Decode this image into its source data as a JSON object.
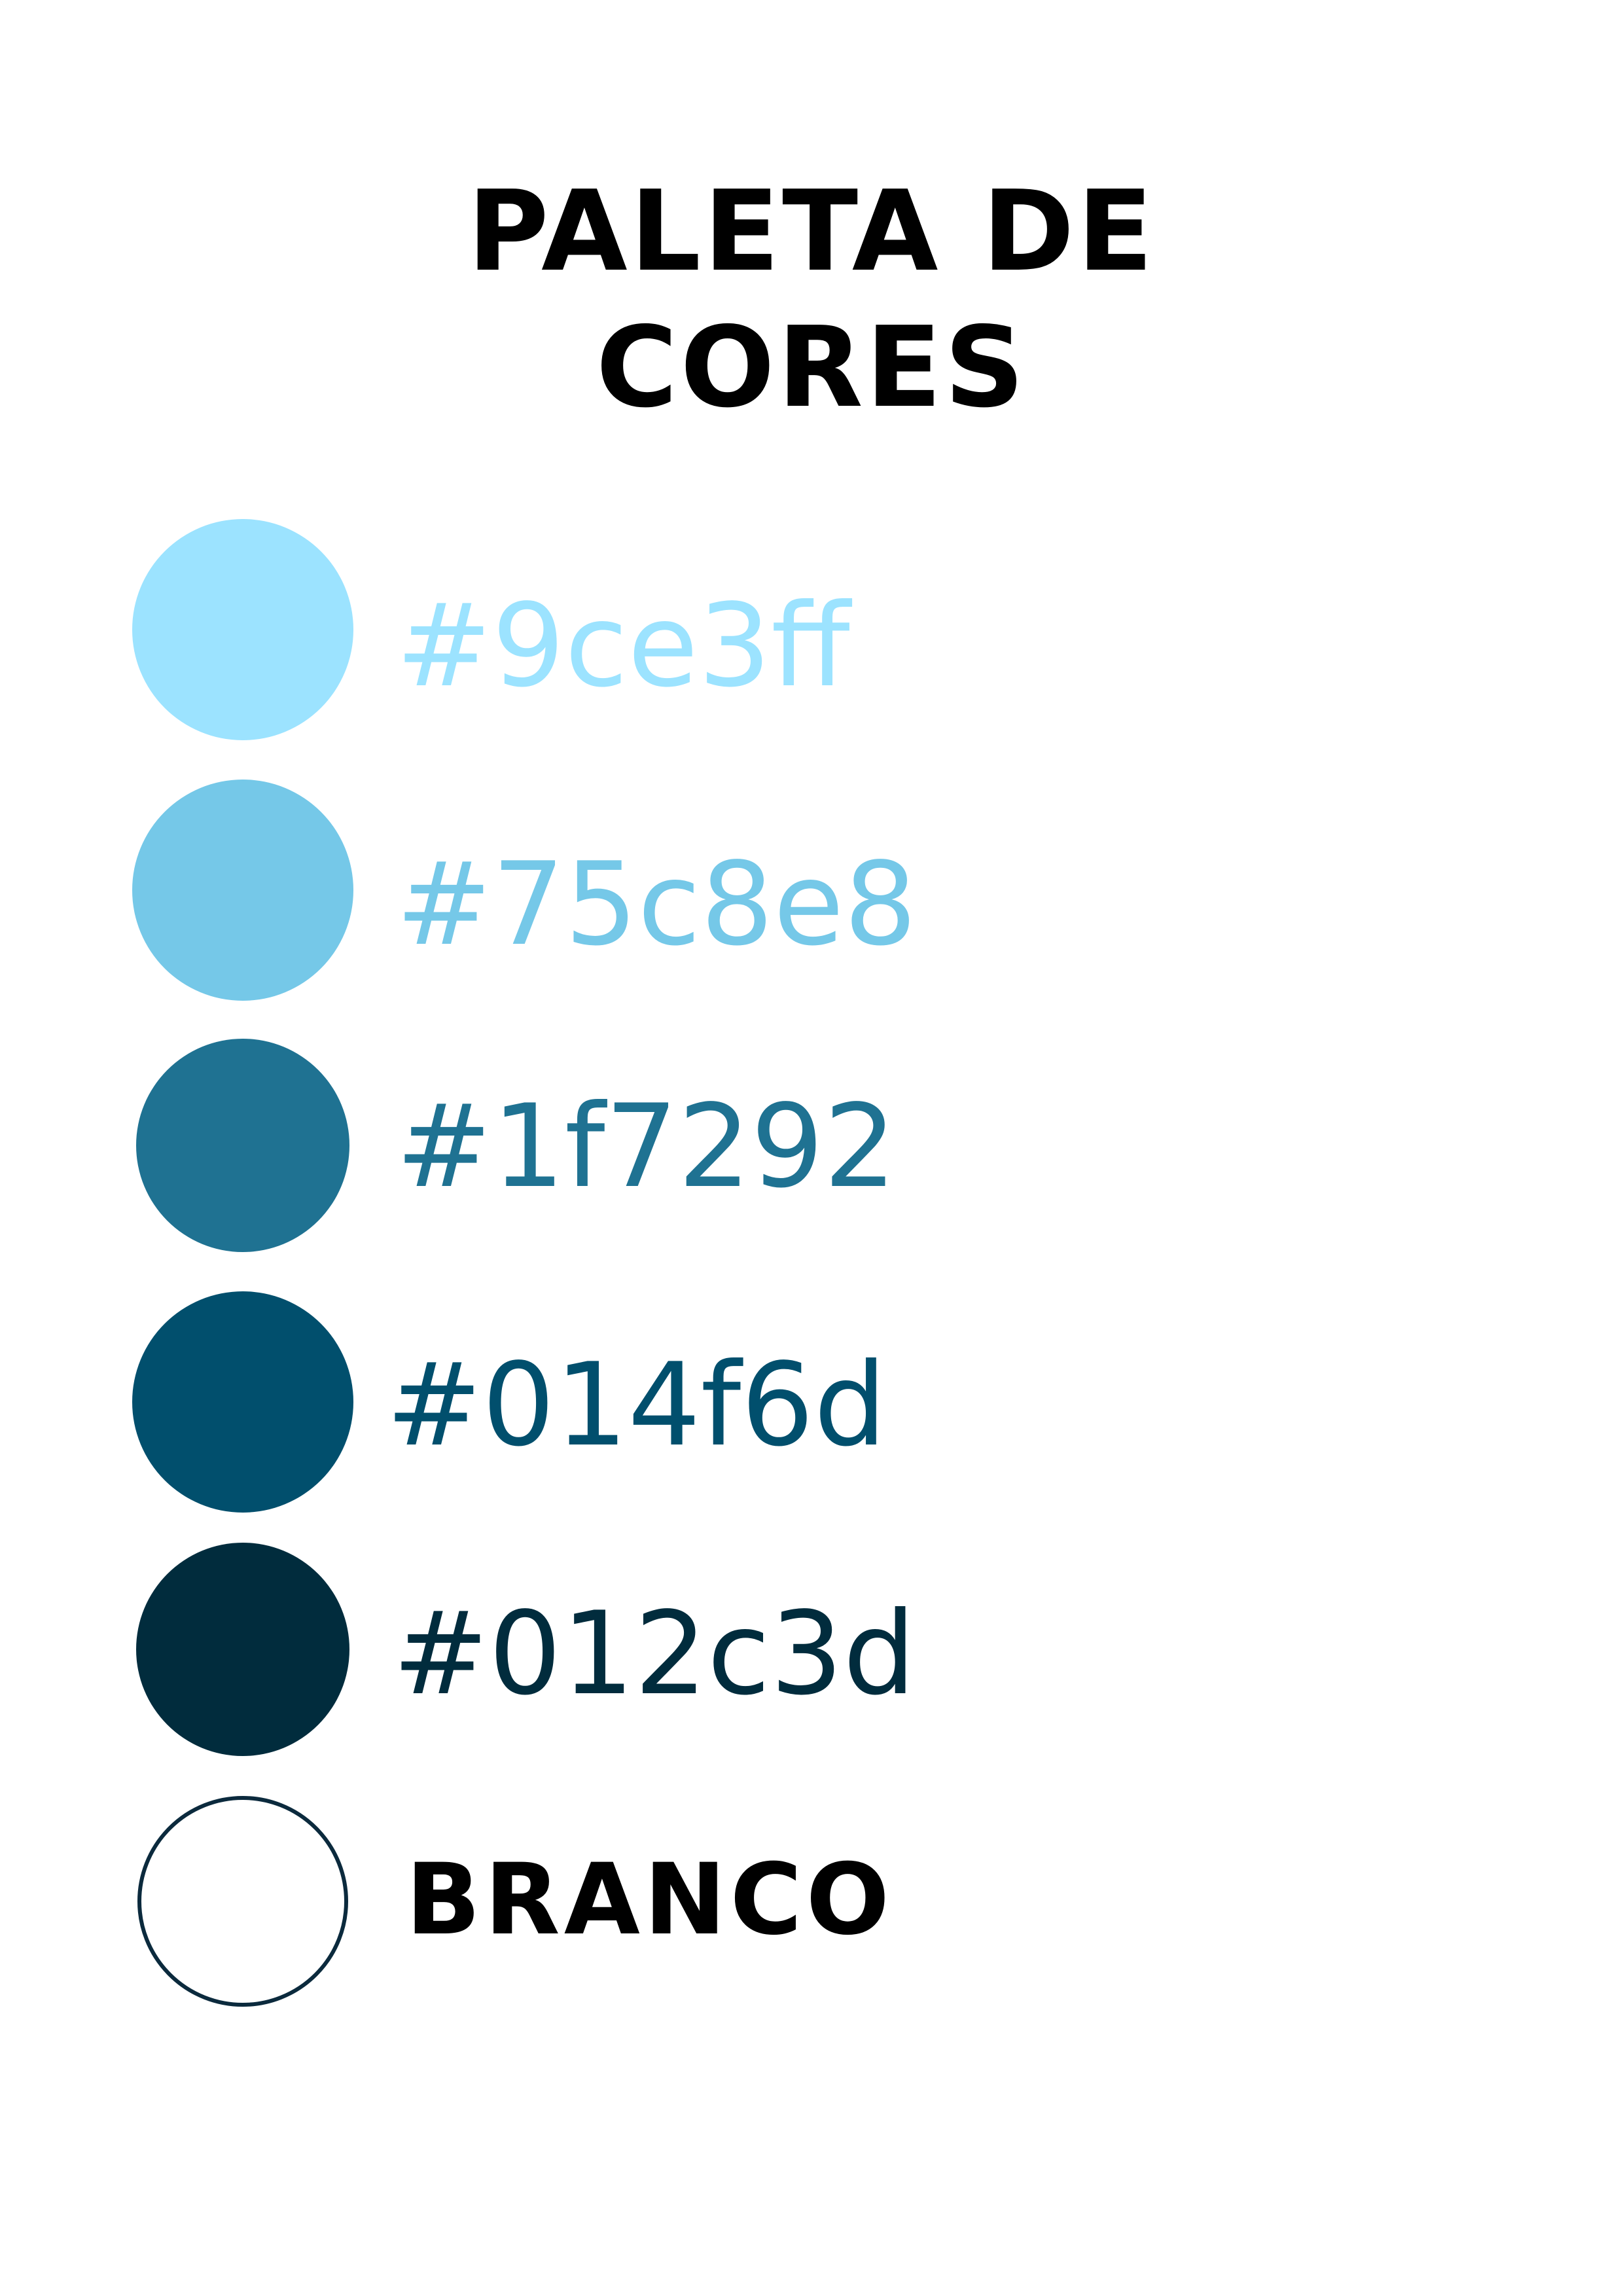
{
  "title": {
    "line1": "PALETA DE",
    "line2": "CORES"
  },
  "palette": [
    {
      "label": "#9ce3ff",
      "color": "#9ce3ff",
      "text_color": "#9ce3ff"
    },
    {
      "label": "#75c8e8",
      "color": "#75c8e8",
      "text_color": "#75c8e8"
    },
    {
      "label": "#1f7292",
      "color": "#1f7292",
      "text_color": "#1f7292"
    },
    {
      "label": "#014f6d",
      "color": "#014f6d",
      "text_color": "#014f6d"
    },
    {
      "label": "#012c3d",
      "color": "#012c3d",
      "text_color": "#012c3d"
    },
    {
      "label": "BRANCO",
      "color": "#ffffff",
      "text_color": "#000000",
      "outline": "#0b2a3d"
    }
  ]
}
